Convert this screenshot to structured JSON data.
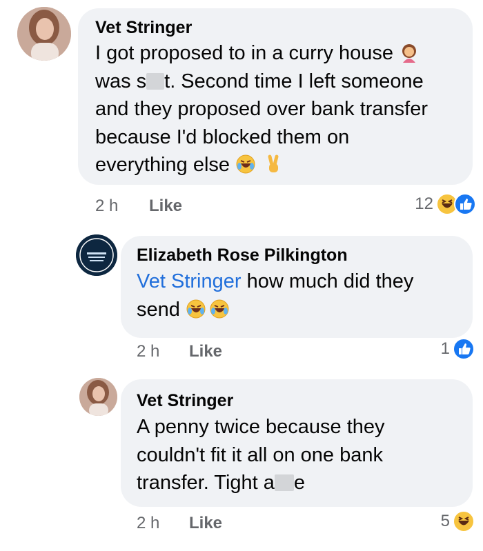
{
  "comments": [
    {
      "author": "Vet Stringer",
      "lines": [
        {
          "parts": [
            "I got proposed to in a curry house "
          ]
        },
        {
          "parts": [
            "was s",
            "t. Second time I left someone"
          ]
        },
        {
          "parts": [
            "and they proposed over bank transfer"
          ]
        },
        {
          "parts": [
            "because I'd blocked them on"
          ]
        },
        {
          "parts": [
            "everything else "
          ]
        }
      ],
      "time": "2 h",
      "like_label": "Like",
      "reaction_count": "12",
      "reactions": [
        "haha",
        "like"
      ]
    },
    {
      "author": "Elizabeth Rose Pilkington",
      "mention": "Vet Stringer",
      "line1_rest": " how much did they",
      "line2": "send ",
      "time": "2 h",
      "like_label": "Like",
      "reaction_count": "1",
      "reactions": [
        "like"
      ]
    },
    {
      "author": "Vet Stringer",
      "lines": [
        {
          "parts": [
            "A penny twice because they"
          ]
        },
        {
          "parts": [
            "couldn't fit it all on one bank"
          ]
        },
        {
          "parts": [
            "transfer. Tight a",
            "e"
          ]
        }
      ],
      "time": "2 h",
      "like_label": "Like",
      "reaction_count": "5",
      "reactions": [
        "haha"
      ]
    }
  ],
  "colors": {
    "bubble": "#f0f2f5",
    "mention": "#216fdb",
    "meta": "#65676b",
    "like_blue": "#1877f2",
    "haha_yellow": "#f7c43f"
  },
  "icons": [
    "person-facepalming-icon",
    "rofl-icon",
    "victory-hand-icon",
    "haha-reaction-icon",
    "like-reaction-icon"
  ]
}
